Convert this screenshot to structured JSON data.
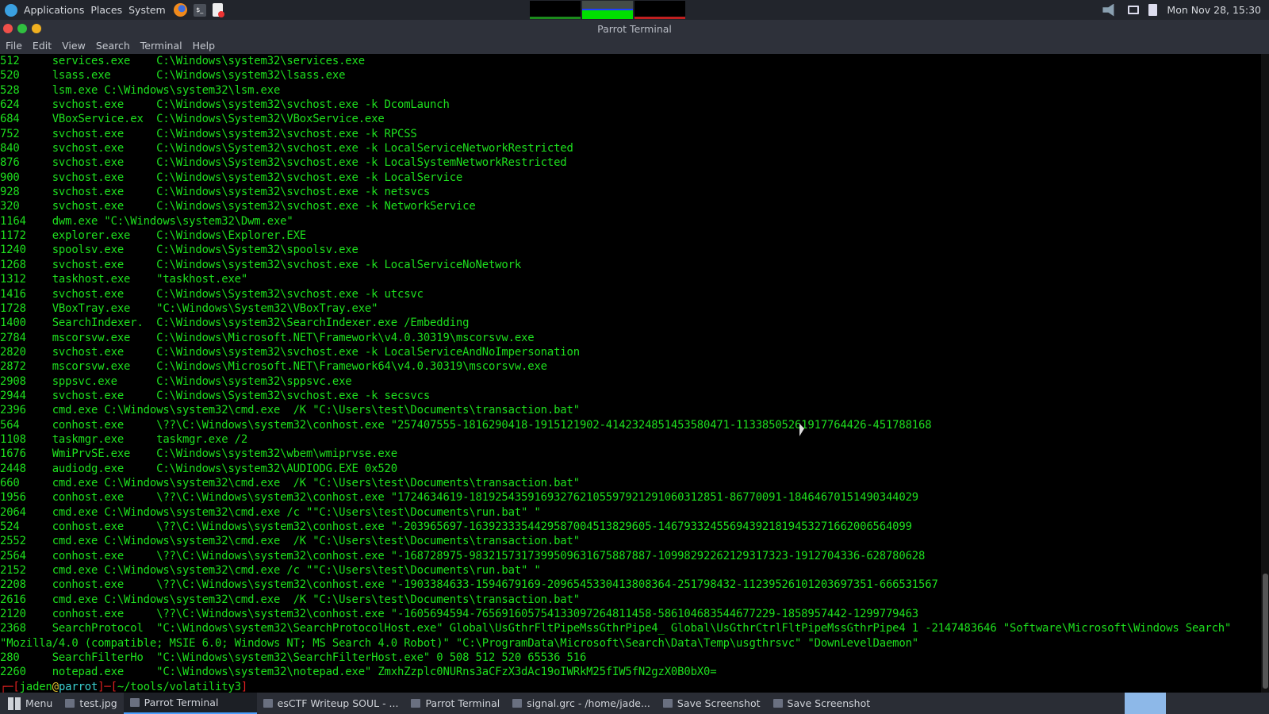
{
  "topbar": {
    "applications": "Applications",
    "places": "Places",
    "system": "System",
    "clock": "Mon Nov 28, 15:30"
  },
  "window": {
    "title": "Parrot Terminal",
    "menu": [
      "File",
      "Edit",
      "View",
      "Search",
      "Terminal",
      "Help"
    ]
  },
  "terminal": {
    "lines": [
      [
        "512",
        "services.exe",
        "C:\\Windows\\system32\\services.exe"
      ],
      [
        "520",
        "lsass.exe",
        "C:\\Windows\\system32\\lsass.exe"
      ],
      [
        "528",
        "lsm.exe",
        "C:\\Windows\\system32\\lsm.exe"
      ],
      [
        "624",
        "svchost.exe",
        "C:\\Windows\\system32\\svchost.exe -k DcomLaunch"
      ],
      [
        "684",
        "VBoxService.ex",
        "C:\\Windows\\System32\\VBoxService.exe"
      ],
      [
        "752",
        "svchost.exe",
        "C:\\Windows\\system32\\svchost.exe -k RPCSS"
      ],
      [
        "840",
        "svchost.exe",
        "C:\\Windows\\System32\\svchost.exe -k LocalServiceNetworkRestricted"
      ],
      [
        "876",
        "svchost.exe",
        "C:\\Windows\\System32\\svchost.exe -k LocalSystemNetworkRestricted"
      ],
      [
        "900",
        "svchost.exe",
        "C:\\Windows\\system32\\svchost.exe -k LocalService"
      ],
      [
        "928",
        "svchost.exe",
        "C:\\Windows\\system32\\svchost.exe -k netsvcs"
      ],
      [
        "320",
        "svchost.exe",
        "C:\\Windows\\system32\\svchost.exe -k NetworkService"
      ],
      [
        "1164",
        "dwm.exe",
        "\"C:\\Windows\\system32\\Dwm.exe\""
      ],
      [
        "1172",
        "explorer.exe",
        "C:\\Windows\\Explorer.EXE"
      ],
      [
        "1240",
        "spoolsv.exe",
        "C:\\Windows\\System32\\spoolsv.exe"
      ],
      [
        "1268",
        "svchost.exe",
        "C:\\Windows\\system32\\svchost.exe -k LocalServiceNoNetwork"
      ],
      [
        "1312",
        "taskhost.exe",
        "\"taskhost.exe\""
      ],
      [
        "1416",
        "svchost.exe",
        "C:\\Windows\\System32\\svchost.exe -k utcsvc"
      ],
      [
        "1728",
        "VBoxTray.exe",
        "\"C:\\Windows\\System32\\VBoxTray.exe\""
      ],
      [
        "1400",
        "SearchIndexer.",
        "C:\\Windows\\system32\\SearchIndexer.exe /Embedding"
      ],
      [
        "2784",
        "mscorsvw.exe",
        "C:\\Windows\\Microsoft.NET\\Framework\\v4.0.30319\\mscorsvw.exe"
      ],
      [
        "2820",
        "svchost.exe",
        "C:\\Windows\\system32\\svchost.exe -k LocalServiceAndNoImpersonation"
      ],
      [
        "2872",
        "mscorsvw.exe",
        "C:\\Windows\\Microsoft.NET\\Framework64\\v4.0.30319\\mscorsvw.exe"
      ],
      [
        "2908",
        "sppsvc.exe",
        "C:\\Windows\\system32\\sppsvc.exe"
      ],
      [
        "2944",
        "svchost.exe",
        "C:\\Windows\\System32\\svchost.exe -k secsvcs"
      ],
      [
        "2396",
        "cmd.exe",
        "C:\\Windows\\system32\\cmd.exe  /K \"C:\\Users\\test\\Documents\\transaction.bat\""
      ],
      [
        "564",
        "conhost.exe",
        "\\??\\C:\\Windows\\system32\\conhost.exe \"257407555-1816290418-1915121902-4142324851453580471-1133850526191776442​6-451788168"
      ],
      [
        "1108",
        "taskmgr.exe",
        "taskmgr.exe /2"
      ],
      [
        "1676",
        "WmiPrvSE.exe",
        "C:\\Windows\\system32\\wbem\\wmiprvse.exe"
      ],
      [
        "2448",
        "audiodg.exe",
        "C:\\Windows\\system32\\AUDIODG.EXE 0x520"
      ],
      [
        "660",
        "cmd.exe",
        "C:\\Windows\\system32\\cmd.exe  /K \"C:\\Users\\test\\Documents\\transaction.bat\""
      ],
      [
        "1956",
        "conhost.exe",
        "\\??\\C:\\Windows\\system32\\conhost.exe \"1724634619-1819254359169327621055979212910603128​51-86770091-1846467015149034402​9"
      ],
      [
        "2064",
        "cmd.exe",
        "C:\\Windows\\system32\\cmd.exe /c \"\"C:\\Users\\test\\Documents\\run.bat\" \""
      ],
      [
        "524",
        "conhost.exe",
        "\\??\\C:\\Windows\\system32\\conhost.exe \"-203965697-1639233354429587004513829605-1467933245569439218194532716620065640​99"
      ],
      [
        "2552",
        "cmd.exe",
        "C:\\Windows\\system32\\cmd.exe  /K \"C:\\Users\\test\\Documents\\transaction.bat\""
      ],
      [
        "2564",
        "conhost.exe",
        "\\??\\C:\\Windows\\system32\\conhost.exe \"-168728975-9832157317399509631675887887-1099829226212931732​3-1912704336-628780628"
      ],
      [
        "2152",
        "cmd.exe",
        "C:\\Windows\\system32\\cmd.exe /c \"\"C:\\Users\\test\\Documents\\run.bat\" \""
      ],
      [
        "2208",
        "conhost.exe",
        "\\??\\C:\\Windows\\system32\\conhost.exe \"-1903384633-1594679169-2096545330413808364-251798432-1123952610120369735​1-666531567"
      ],
      [
        "2616",
        "cmd.exe",
        "C:\\Windows\\system32\\cmd.exe  /K \"C:\\Users\\test\\Documents\\transaction.bat\""
      ],
      [
        "2120",
        "conhost.exe",
        "\\??\\C:\\Windows\\system32\\conhost.exe \"-1605694594-7656916057541330972648114​58-586104683544677229-1858957442-1299779463"
      ],
      [
        "2368",
        "SearchProtocol",
        "\"C:\\Windows\\system32\\SearchProtocolHost.exe\" Global\\UsGthrFltPipeMssGthrPipe4_ Global\\UsGthrCtrlFltPipeMssGthrPipe4 1 -2147483646 \"Software\\Microsoft\\Windows Search\""
      ],
      [
        "",
        "",
        "\"Mozilla/4.0 (compatible; MSIE 6.0; Windows NT; MS Search 4.0 Robot)\" \"C:\\ProgramData\\Microsoft\\Search\\Data\\Temp\\usgthrsvc\" \"DownLevelDaemon\""
      ],
      [
        "280",
        "SearchFilterHo",
        "\"C:\\Windows\\system32\\SearchFilterHost.exe\" 0 508 512 520 65536 516"
      ],
      [
        "2260",
        "notepad.exe",
        "\"C:\\Windows\\system32\\notepad.exe\" ZmxhZzplc0NURns3aCFzX3dAc19oIWRkM25fIW5fN2gzX0B0bX0="
      ]
    ],
    "prompt": {
      "corner": "┌─[",
      "user": "jaden",
      "at": "@",
      "host": "parrot",
      "sep": "]─[",
      "path": "~/tools/volatility3",
      "end": "]"
    }
  },
  "taskbar": {
    "items": [
      {
        "label": "Menu",
        "icon": "grid-icon"
      },
      {
        "label": "test.jpg",
        "icon": "image-viewer-icon"
      },
      {
        "label": "Parrot Terminal",
        "icon": "terminal-icon",
        "active": true
      },
      {
        "label": "esCTF Writeup SOUL - ...",
        "icon": "firefox-icon"
      },
      {
        "label": "Parrot Terminal",
        "icon": "terminal-icon"
      },
      {
        "label": "signal.grc - /home/jade...",
        "icon": "gnuradio-icon"
      },
      {
        "label": "Save Screenshot",
        "icon": "screenshot-icon"
      },
      {
        "label": "Save Screenshot",
        "icon": "screenshot-icon"
      }
    ]
  },
  "colors": {
    "terminal_text": "#1ee01e",
    "prompt_red": "#e02020",
    "prompt_cyan": "#3ad0d0"
  }
}
